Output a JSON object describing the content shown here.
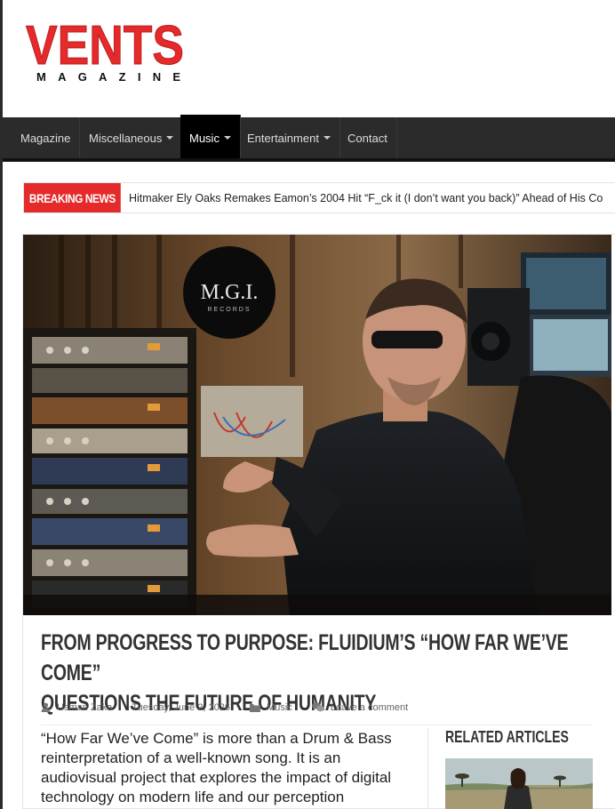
{
  "logo": {
    "main": "VENTS",
    "sub": "MAGAZINE"
  },
  "nav": {
    "items": [
      {
        "label": "Magazine",
        "dropdown": false
      },
      {
        "label": "Miscellaneous",
        "dropdown": true
      },
      {
        "label": "Music",
        "dropdown": true,
        "active": true
      },
      {
        "label": "Entertainment",
        "dropdown": true
      },
      {
        "label": "Contact",
        "dropdown": false
      }
    ]
  },
  "breaking": {
    "label": "BREAKING NEWS",
    "headline": "Hitmaker Ely Oaks Remakes Eamon’s 2004 Hit “F_ck it (I don’t want you back)” Ahead of His Co"
  },
  "article": {
    "hero_logo_main": "M.G.I.",
    "hero_logo_sub": "RECORDS",
    "title_line1": "From Progress to Purpose: Fluidium’s “How Far We’ve Come”",
    "title_line2": "Questions the Future of Humanity",
    "author": "Usman Zaka",
    "date": "Tuesday, June 2, 2026",
    "category": "Music",
    "comments": "Leave a comment",
    "body": "“How Far We’ve Come” is more than a Drum & Bass reinterpretation of a well-known song. It is an audiovisual project that explores the impact of digital technology on modern life and our perception"
  },
  "sidebar": {
    "related_title": "RELATED ARTICLES"
  },
  "colors": {
    "accent": "#e42a2a",
    "nav_bg": "#2b2b2b",
    "nav_active": "#000000"
  },
  "icons": {
    "author": "user-icon",
    "category": "folder-icon",
    "comments": "comments-icon"
  }
}
